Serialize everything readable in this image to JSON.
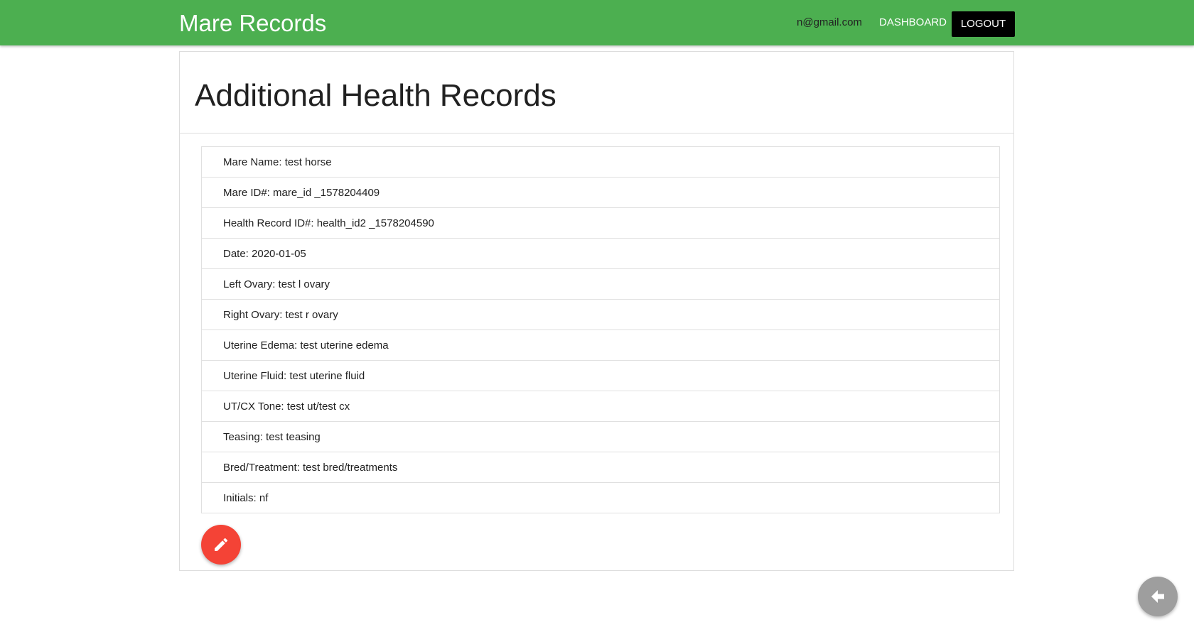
{
  "navbar": {
    "brand": "Mare Records",
    "email": "n@gmail.com",
    "dashboard_label": "DASHBOARD",
    "logout_label": "LOGOUT",
    "bg_color": "#4caf50"
  },
  "page": {
    "title": "Additional Health Records"
  },
  "record": {
    "items": [
      "Mare Name: test horse",
      "Mare ID#: mare_id _1578204409",
      "Health Record ID#: health_id2 _1578204590",
      "Date: 2020-01-05",
      "Left Ovary: test l ovary",
      "Right Ovary: test r ovary",
      "Uterine Edema: test uterine edema",
      "Uterine Fluid: test uterine fluid",
      "UT/CX Tone: test ut/test cx",
      "Teasing: test teasing",
      "Bred/Treatment: test bred/treatments",
      "Initials: nf"
    ]
  },
  "actions": {
    "edit_icon": "pencil-icon",
    "edit_color": "#f44336",
    "back_icon": "arrow-left-icon",
    "back_color": "#9e9e9e"
  }
}
